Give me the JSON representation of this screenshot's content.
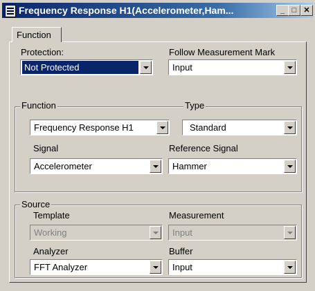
{
  "window": {
    "title": "Frequency Response H1(Accelerometer,Ham...",
    "minimize": "_",
    "maximize": "□",
    "close": "✕"
  },
  "tabs": [
    {
      "label": "Function"
    }
  ],
  "protection": {
    "label": "Protection:",
    "value": "Not Protected"
  },
  "follow": {
    "label": "Follow Measurement Mark",
    "value": "Input"
  },
  "function_group": {
    "title": "Function",
    "type_title": "Type",
    "function_value": "Frequency Response H1",
    "type_value": "Standard",
    "signal_label": "Signal",
    "signal_value": "Accelerometer",
    "reference_label": "Reference Signal",
    "reference_value": "Hammer"
  },
  "source_group": {
    "title": "Source",
    "template_label": "Template",
    "template_value": "Working",
    "measurement_label": "Measurement",
    "measurement_value": "Input",
    "analyzer_label": "Analyzer",
    "analyzer_value": "FFT Analyzer",
    "buffer_label": "Buffer",
    "buffer_value": "Input"
  }
}
